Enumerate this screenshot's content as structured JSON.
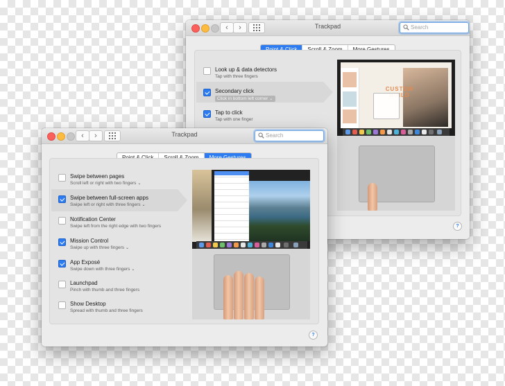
{
  "back_window": {
    "title": "Trackpad",
    "search_placeholder": "Search",
    "nav_back": "‹",
    "nav_forward": "›",
    "tabs": [
      {
        "label": "Point & Click",
        "active": true
      },
      {
        "label": "Scroll & Zoom",
        "active": false
      },
      {
        "label": "More Gestures",
        "active": false
      }
    ],
    "options": [
      {
        "title": "Look up & data detectors",
        "subtitle": "Tap with three fingers",
        "checked": false
      },
      {
        "title": "Secondary click",
        "subtitle": "Click in bottom left corner ⌄",
        "checked": true
      },
      {
        "title": "Tap to click",
        "subtitle": "Tap with one finger",
        "checked": true
      }
    ],
    "preview_text": "CUSTOM BUILD",
    "help": "?"
  },
  "front_window": {
    "title": "Trackpad",
    "search_placeholder": "Search",
    "nav_back": "‹",
    "nav_forward": "›",
    "tabs": [
      {
        "label": "Point & Click",
        "active": false
      },
      {
        "label": "Scroll & Zoom",
        "active": false
      },
      {
        "label": "More Gestures",
        "active": true
      }
    ],
    "options": [
      {
        "title": "Swipe between pages",
        "subtitle": "Scroll left or right with two fingers",
        "checked": false,
        "dropdown": true
      },
      {
        "title": "Swipe between full-screen apps",
        "subtitle": "Swipe left or right with three fingers",
        "checked": true,
        "dropdown": true
      },
      {
        "title": "Notification Center",
        "subtitle": "Swipe left from the right edge with two fingers",
        "checked": false,
        "dropdown": false
      },
      {
        "title": "Mission Control",
        "subtitle": "Swipe up with three fingers",
        "checked": true,
        "dropdown": true
      },
      {
        "title": "App Exposé",
        "subtitle": "Swipe down with three fingers",
        "checked": true,
        "dropdown": true
      },
      {
        "title": "Launchpad",
        "subtitle": "Pinch with thumb and three fingers",
        "checked": false,
        "dropdown": false
      },
      {
        "title": "Show Desktop",
        "subtitle": "Spread with thumb and three fingers",
        "checked": false,
        "dropdown": false
      }
    ],
    "help": "?"
  },
  "colors": {
    "accent": "#2d7bf0",
    "close": "#fc605c",
    "minimize": "#fdbc40",
    "window_bg": "#ececec"
  }
}
